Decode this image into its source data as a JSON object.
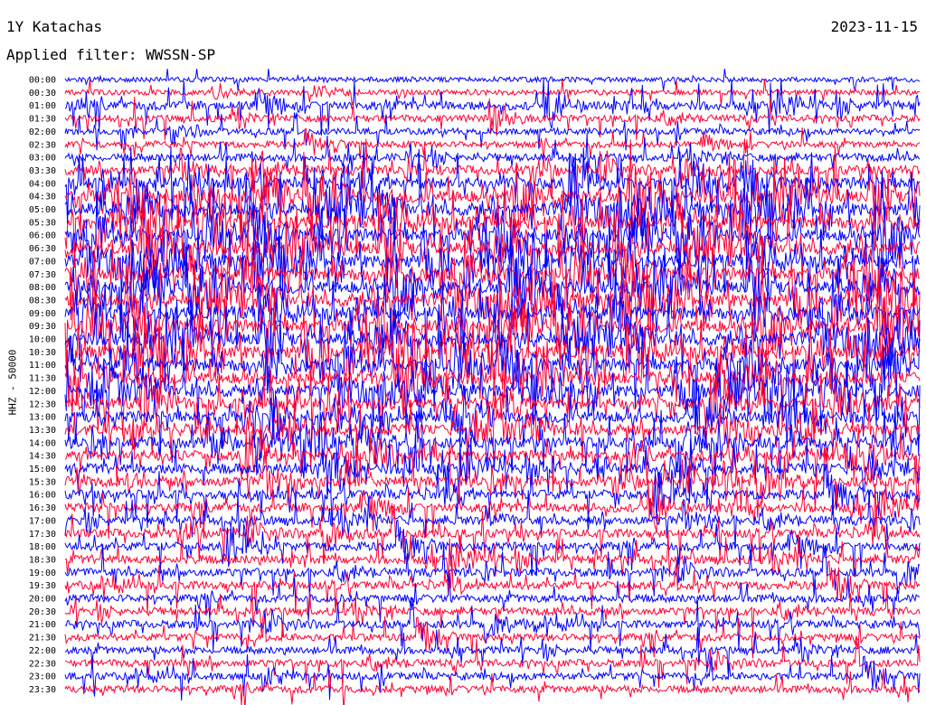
{
  "header": {
    "station": "1Y Katachas",
    "date": "2023-11-15",
    "filter_label": "Applied filter: WWSSN-SP",
    "channel_label": "HHZ - 50000"
  },
  "colors": {
    "even_trace": "#0000ff",
    "odd_trace": "#ff0033",
    "background": "#ffffff",
    "text": "#000000"
  },
  "chart_data": {
    "type": "helicorder",
    "title": "1Y Katachas",
    "ylabel": "HHZ - 50000",
    "row_labels": [
      "00:00",
      "00:30",
      "01:00",
      "01:30",
      "02:00",
      "02:30",
      "03:00",
      "03:30",
      "04:00",
      "04:30",
      "05:00",
      "05:30",
      "06:00",
      "06:30",
      "07:00",
      "07:30",
      "08:00",
      "08:30",
      "09:00",
      "09:30",
      "10:00",
      "10:30",
      "11:00",
      "11:30",
      "12:00",
      "12:30",
      "13:00",
      "13:30",
      "14:00",
      "14:30",
      "15:00",
      "15:30",
      "16:00",
      "16:30",
      "17:00",
      "17:30",
      "18:00",
      "18:30",
      "19:00",
      "19:30",
      "20:00",
      "20:30",
      "21:00",
      "21:30",
      "22:00",
      "22:30",
      "23:00",
      "23:30"
    ],
    "row_activity": [
      0.15,
      0.2,
      0.6,
      0.35,
      0.3,
      0.3,
      0.45,
      0.6,
      0.9,
      1.0,
      1.0,
      1.0,
      1.0,
      1.0,
      1.0,
      1.0,
      1.0,
      1.0,
      1.0,
      1.0,
      1.0,
      1.0,
      1.0,
      0.95,
      0.9,
      0.85,
      0.85,
      0.8,
      0.8,
      0.75,
      0.75,
      0.7,
      0.65,
      0.6,
      0.55,
      0.55,
      0.55,
      0.55,
      0.5,
      0.5,
      0.45,
      0.45,
      0.45,
      0.4,
      0.4,
      0.4,
      0.4,
      0.4
    ],
    "grid": false
  }
}
